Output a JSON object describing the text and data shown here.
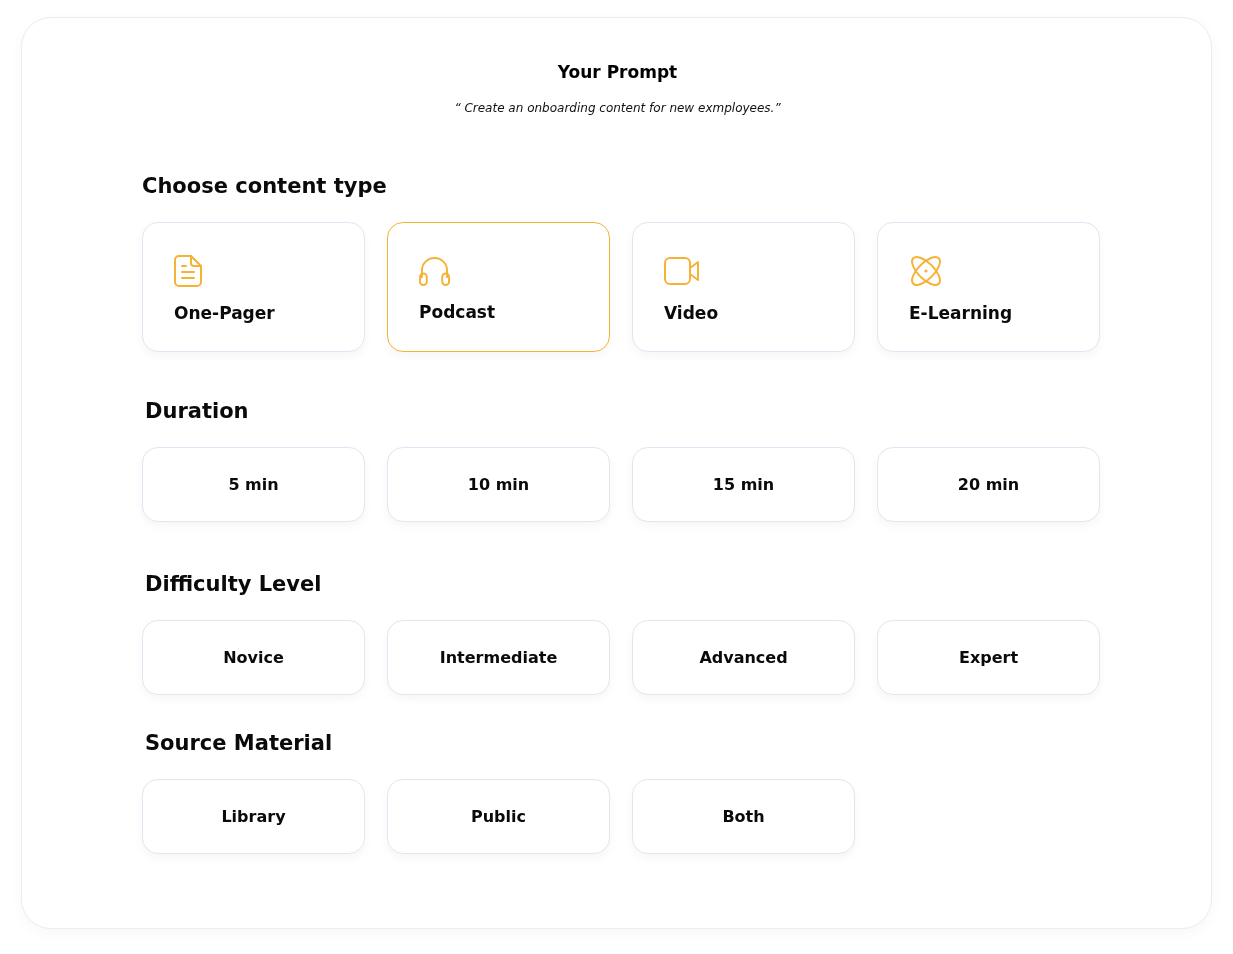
{
  "prompt": {
    "title": "Your Prompt",
    "quote": "“ Create an onboarding content for new exmployees.”"
  },
  "sections": [
    {
      "heading": "Choose content type",
      "kind": "cards",
      "options": [
        {
          "label": "One-Pager",
          "selected": false
        },
        {
          "label": "Podcast",
          "selected": true
        },
        {
          "label": "Video",
          "selected": false
        },
        {
          "label": "E-Learning",
          "selected": false
        }
      ]
    },
    {
      "heading": "Duration",
      "kind": "buttons",
      "options": [
        {
          "label": "5 min",
          "selected": false
        },
        {
          "label": "10 min",
          "selected": false
        },
        {
          "label": "15 min",
          "selected": false
        },
        {
          "label": "20 min",
          "selected": false
        }
      ]
    },
    {
      "heading": "Difficulty Level",
      "kind": "buttons",
      "options": [
        {
          "label": "Novice",
          "selected": false
        },
        {
          "label": "Intermediate",
          "selected": false
        },
        {
          "label": "Advanced",
          "selected": false
        },
        {
          "label": "Expert",
          "selected": false
        }
      ]
    },
    {
      "heading": "Source Material",
      "kind": "buttons",
      "options": [
        {
          "label": "Library",
          "selected": false
        },
        {
          "label": "Public",
          "selected": false
        },
        {
          "label": "Both",
          "selected": false
        }
      ]
    }
  ]
}
